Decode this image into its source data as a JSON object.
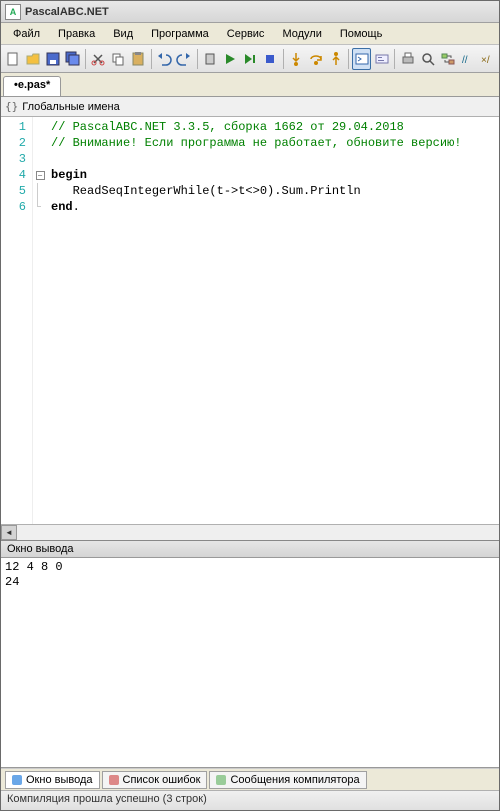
{
  "title": "PascalABC.NET",
  "menu": [
    "Файл",
    "Правка",
    "Вид",
    "Программа",
    "Сервис",
    "Модули",
    "Помощь"
  ],
  "tab": "•e.pas*",
  "namespace_label": "Глобальные имена",
  "code": {
    "lines": [
      "1",
      "2",
      "3",
      "4",
      "5",
      "6"
    ],
    "l1": "// PascalABC.NET 3.3.5, сборка 1662 от 29.04.2018",
    "l2": "// Внимание! Если программа не работает, обновите версию!",
    "l3": "",
    "l4_kw": "begin",
    "l5": "   ReadSeqIntegerWhile(t->t<>0).Sum.Println",
    "l6_kw": "end",
    "l6_tail": "."
  },
  "output_title": "Окно вывода",
  "output_body": "12 4 8 0\n24",
  "bottom_tabs": {
    "out": "Окно вывода",
    "err": "Список ошибок",
    "msg": "Сообщения компилятора"
  },
  "status": "Компиляция прошла успешно (3 строк)"
}
